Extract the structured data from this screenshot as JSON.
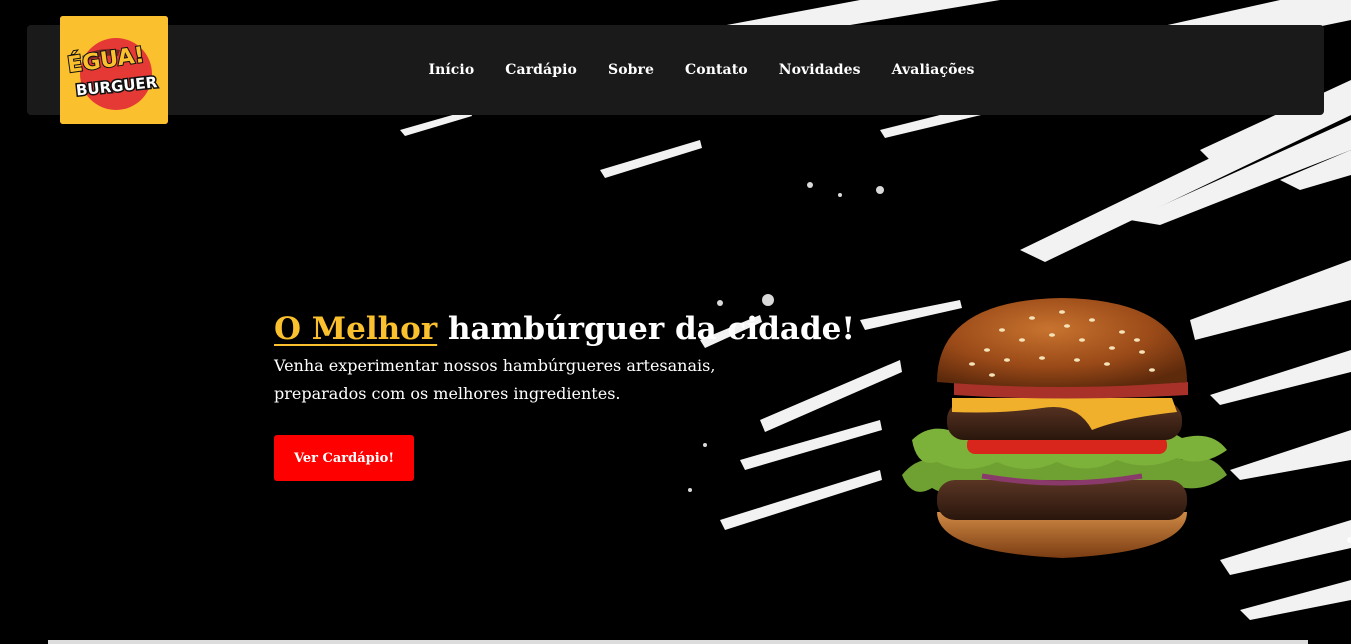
{
  "brand": {
    "logo_line1": "ÉGUA!",
    "logo_line2": "BURGUER",
    "color_yellow": "#fbc02d",
    "color_red": "#e53935"
  },
  "nav": {
    "items": [
      {
        "label": "Início"
      },
      {
        "label": "Cardápio"
      },
      {
        "label": "Sobre"
      },
      {
        "label": "Contato"
      },
      {
        "label": "Novidades"
      },
      {
        "label": "Avaliações"
      }
    ]
  },
  "hero": {
    "title_accent": "O Melhor",
    "title_rest": " hambúrguer da cidade!",
    "subtitle": "Venha experimentar nossos hambúrgueres artesanais, preparados com os melhores ingredientes.",
    "cta_label": "Ver Cardápio!",
    "cta_color": "#ff0000",
    "image": "burger-image"
  }
}
